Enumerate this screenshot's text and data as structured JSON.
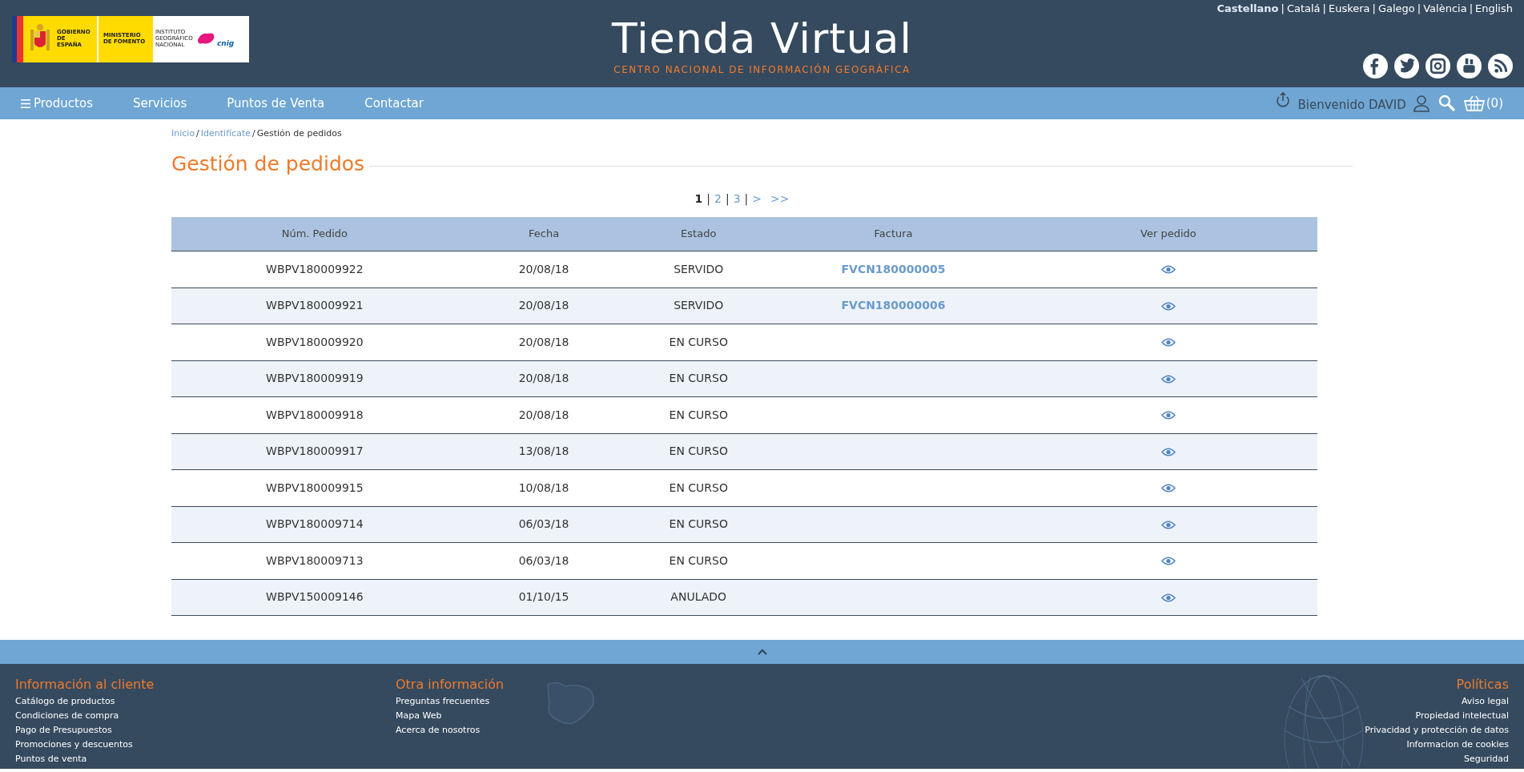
{
  "logo": {
    "texts": [
      "GOBIERNO DE ESPAÑA",
      "MINISTERIO DE FOMENTO",
      "INSTITUTO GEOGRÁFICO NACIONAL",
      "cnig"
    ]
  },
  "site": {
    "title": "Tienda Virtual",
    "subtitle": "CENTRO NACIONAL DE INFORMACIÓN GEOGRÁFICA"
  },
  "languages": {
    "separator": "|",
    "items": [
      {
        "label": "Castellano",
        "selected": true
      },
      {
        "label": "Catalá",
        "selected": false
      },
      {
        "label": "Euskera",
        "selected": false
      },
      {
        "label": "Galego",
        "selected": false
      },
      {
        "label": "València",
        "selected": false
      },
      {
        "label": "English",
        "selected": false
      }
    ]
  },
  "social": [
    {
      "kind": "facebook"
    },
    {
      "kind": "twitter"
    },
    {
      "kind": "instagram"
    },
    {
      "kind": "youtube"
    },
    {
      "kind": "rss"
    }
  ],
  "nav": {
    "items": [
      "Productos",
      "Servicios",
      "Puntos de Venta",
      "Contactar"
    ],
    "welcome": "Bienvenido DAVID",
    "cart_count": "(0)"
  },
  "breadcrumb": {
    "separator": "/",
    "items": [
      {
        "label": "Inicio",
        "link": true
      },
      {
        "label": "Identifícate",
        "link": true
      },
      {
        "label": "Gestión de pedidos",
        "link": false
      }
    ]
  },
  "page_title": "Gestión de pedidos",
  "pagination": {
    "separator": "|",
    "pages": [
      {
        "label": "1",
        "selected": true
      },
      {
        "label": "2",
        "selected": false
      },
      {
        "label": "3",
        "selected": false
      }
    ],
    "next": ">",
    "last": ">>"
  },
  "table": {
    "columns": [
      "Núm. Pedido",
      "Fecha",
      "Estado",
      "Factura",
      "Ver pedido"
    ],
    "rows": [
      {
        "order": "WBPV180009922",
        "date": "20/08/18",
        "status": "SERVIDO",
        "invoice": "FVCN180000005"
      },
      {
        "order": "WBPV180009921",
        "date": "20/08/18",
        "status": "SERVIDO",
        "invoice": "FVCN180000006"
      },
      {
        "order": "WBPV180009920",
        "date": "20/08/18",
        "status": "EN CURSO"
      },
      {
        "order": "WBPV180009919",
        "date": "20/08/18",
        "status": "EN CURSO"
      },
      {
        "order": "WBPV180009918",
        "date": "20/08/18",
        "status": "EN CURSO"
      },
      {
        "order": "WBPV180009917",
        "date": "13/08/18",
        "status": "EN CURSO"
      },
      {
        "order": "WBPV180009915",
        "date": "10/08/18",
        "status": "EN CURSO"
      },
      {
        "order": "WBPV180009714",
        "date": "06/03/18",
        "status": "EN CURSO"
      },
      {
        "order": "WBPV180009713",
        "date": "06/03/18",
        "status": "EN CURSO"
      },
      {
        "order": "WBPV150009146",
        "date": "01/10/15",
        "status": "ANULADO"
      }
    ]
  },
  "footer": {
    "columns": [
      {
        "title": "Información al cliente",
        "links": [
          "Catálogo de productos",
          "Condiciones de compra",
          "Pago de Presupuestos",
          "Promociones y descuentos",
          "Puntos de venta"
        ]
      },
      {
        "title": "Otra información",
        "links": [
          "Preguntas frecuentes",
          "Mapa Web",
          "Acerca de nosotros"
        ]
      },
      {
        "title": "Políticas",
        "links": [
          "Aviso legal",
          "Propiedad intelectual",
          "Privacidad y protección de datos",
          "Informacion de cookies",
          "Seguridad"
        ]
      }
    ]
  }
}
